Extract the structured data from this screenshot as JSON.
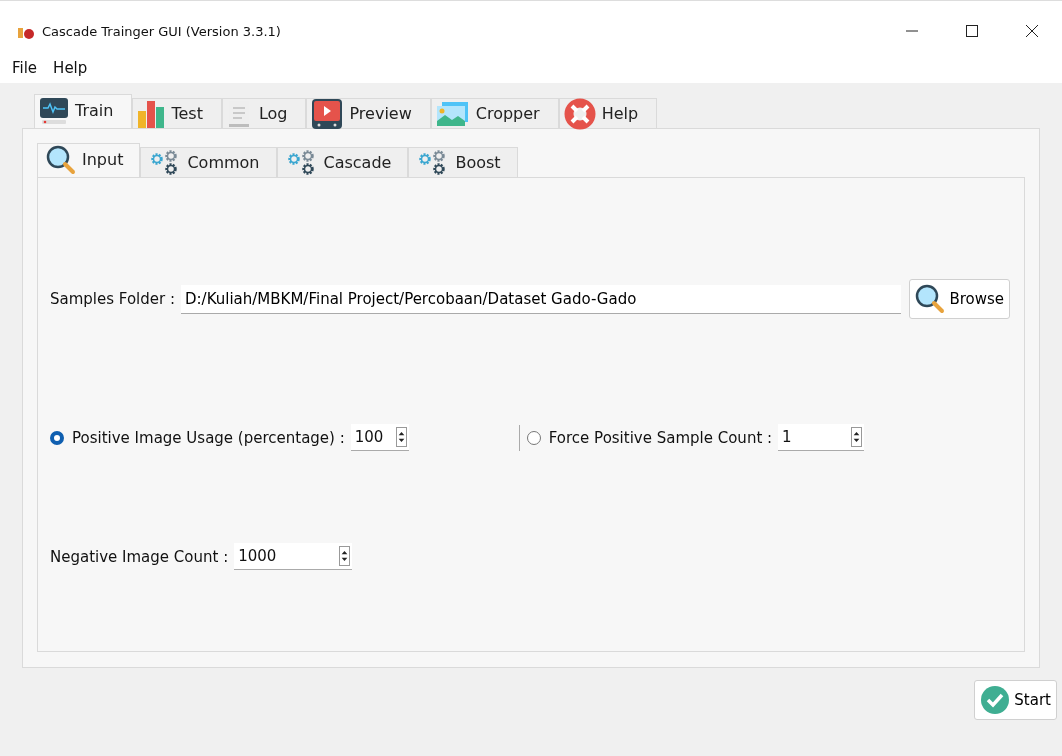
{
  "window": {
    "title": "Cascade Trainger GUI (Version 3.3.1)"
  },
  "menu": [
    "File",
    "Help"
  ],
  "tabs": [
    {
      "label": "Train",
      "kind": "monitor",
      "selected": true
    },
    {
      "label": "Test",
      "kind": "bars",
      "selected": false
    },
    {
      "label": "Log",
      "kind": "document",
      "selected": false
    },
    {
      "label": "Preview",
      "kind": "play",
      "selected": false
    },
    {
      "label": "Cropper",
      "kind": "landscape",
      "selected": false
    },
    {
      "label": "Help",
      "kind": "lifebuoy",
      "selected": false
    }
  ],
  "subtabs": [
    {
      "label": "Input",
      "kind": "magnifier",
      "selected": true
    },
    {
      "label": "Common",
      "kind": "gears",
      "selected": false
    },
    {
      "label": "Cascade",
      "kind": "gears",
      "selected": false
    },
    {
      "label": "Boost",
      "kind": "gears",
      "selected": false
    }
  ],
  "samples_folder": {
    "label": "Samples Folder :",
    "value": "D:/Kuliah/MBKM/Final Project/Percobaan/Dataset Gado-Gado",
    "button": "Browse"
  },
  "positive_usage": {
    "label": "Positive Image Usage (percentage) :",
    "value": "100",
    "selected": true
  },
  "force_positive": {
    "label": "Force Positive Sample Count :",
    "value": "1",
    "selected": false
  },
  "negative_count": {
    "label": "Negative Image Count :",
    "value": "1000"
  },
  "start_button": "Start"
}
